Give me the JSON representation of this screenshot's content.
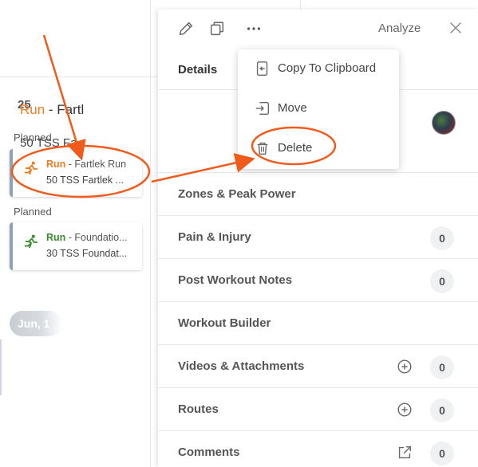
{
  "calendar": {
    "date_number": "25",
    "workouts": [
      {
        "status": "Planned",
        "sport": "Run",
        "title": " - Fartlek Run",
        "tss_line": "50 TSS Fartlek ...",
        "sport_color": "#f07b1d"
      },
      {
        "status": "Planned",
        "sport": "Run",
        "title": " - Foundatio...",
        "tss_line": "30 TSS Foundat...",
        "sport_color": "#3a8a2e"
      }
    ],
    "week_pill": "Jun, 1"
  },
  "panel": {
    "toolbar": {
      "edit_icon": "pencil-icon",
      "copy_icon": "copy-icon",
      "more_icon": "more-horizontal-icon",
      "analyze_label": "Analyze",
      "close_icon": "close-icon"
    },
    "details_tab": "Details",
    "workout": {
      "sport": "Run",
      "title_suffix": " - Fartl",
      "tss_text": "50 TSS Fa"
    },
    "sections": [
      {
        "label": "Zones & Peak Power",
        "count": "",
        "action_icon": ""
      },
      {
        "label": "Pain & Injury",
        "count": "0",
        "action_icon": ""
      },
      {
        "label": "Post Workout Notes",
        "count": "0",
        "action_icon": ""
      },
      {
        "label": "Workout Builder",
        "count": "",
        "action_icon": ""
      },
      {
        "label": "Videos & Attachments",
        "count": "0",
        "action_icon": "plus-circle-icon"
      },
      {
        "label": "Routes",
        "count": "0",
        "action_icon": "plus-circle-icon"
      },
      {
        "label": "Comments",
        "count": "0",
        "action_icon": "external-link-icon"
      }
    ]
  },
  "menu": {
    "items": [
      {
        "label": "Copy To Clipboard",
        "icon": "clipboard-arrow-icon"
      },
      {
        "label": "Move",
        "icon": "move-icon"
      },
      {
        "label": "Delete",
        "icon": "trash-icon"
      }
    ]
  },
  "colors": {
    "accent_orange": "#f07b1d",
    "annotation": "#f05a1a",
    "foundation_green": "#3a8a2e"
  }
}
